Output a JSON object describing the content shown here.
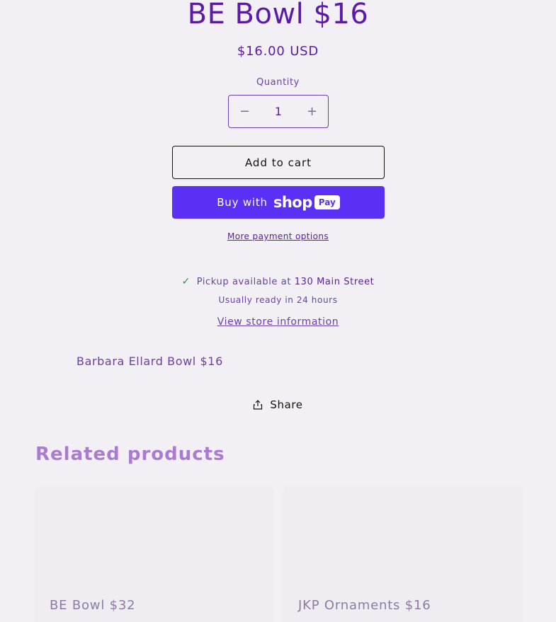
{
  "product": {
    "title": "BE Bowl $16",
    "price": "$16.00 USD",
    "description": "Barbara Ellard Bowl $16"
  },
  "quantity": {
    "label": "Quantity",
    "value": "1",
    "decrease_symbol": "−",
    "increase_symbol": "+"
  },
  "actions": {
    "add_to_cart": "Add to cart",
    "buy_with": "Buy with",
    "shop_word": "shop",
    "pay_badge": "Pay",
    "more_payment": "More payment options",
    "share": "Share"
  },
  "pickup": {
    "check_icon": "✓",
    "available_text": "Pickup available at",
    "store_name": "130 Main Street",
    "ready_text": "Usually ready in 24 hours",
    "store_info_link": "View store information"
  },
  "related": {
    "heading": "Related products",
    "items": [
      {
        "title": "BE Bowl $32"
      },
      {
        "title": "JKP Ornaments $16"
      }
    ]
  },
  "colors": {
    "brand_purple": "#5b1aa8",
    "shop_pay": "#5a31f4",
    "pickup_check": "#2c8a3d"
  }
}
